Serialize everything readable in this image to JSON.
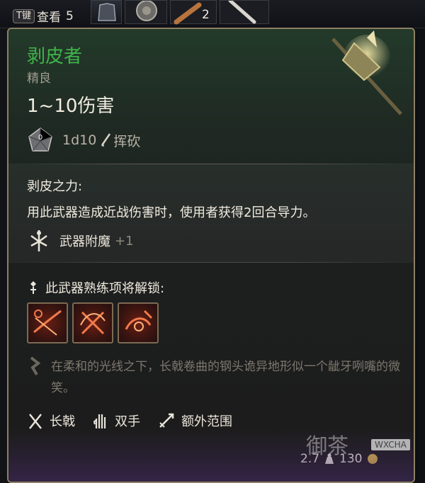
{
  "topbar": {
    "key": "T键",
    "view_label": "查看",
    "slot_count_1": "5",
    "slot_count_2": "2"
  },
  "item": {
    "name": "剥皮者",
    "rarity": "精良",
    "damage": "1~10伤害",
    "dice": "1d10",
    "damage_type": "挥砍",
    "passive_title": "剥皮之力:",
    "passive_desc": "用此武器造成近战伤害时，使用者获得2回合导力。",
    "enchant_name": "武器附魔",
    "enchant_value": "+1",
    "proficiency_title": "此武器熟练项将解锁:",
    "flavor": "在柔和的光线之下，长戟卷曲的钢头诡异地形似一个龇牙咧嘴的微笑。",
    "properties": [
      "长戟",
      "双手",
      "额外范围"
    ],
    "weight": "2.7",
    "price": "130"
  },
  "watermark": {
    "text": "御茶",
    "badge": "WXCHA"
  },
  "colors": {
    "rare_green": "#3fb44a",
    "border_gold": "#8d7f63",
    "text_cream": "#f0ebdf",
    "muted": "#7d786e"
  },
  "icons": [
    "dice-d10-icon",
    "slash-icon",
    "enchant-icon",
    "proficiency-icon",
    "halberd-icon",
    "two-hand-icon",
    "reach-icon",
    "weight-icon",
    "gold-icon",
    "flavor-icon"
  ]
}
